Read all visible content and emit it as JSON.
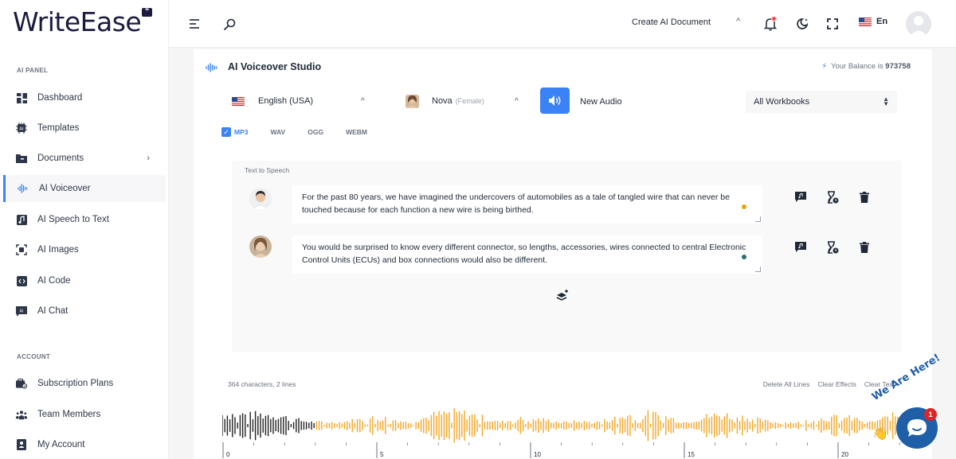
{
  "app": {
    "logo_text": "WriteEase",
    "logo_bubble": "❞"
  },
  "sidebar": {
    "section_ai": "AI PANEL",
    "section_account": "ACCOUNT",
    "items": [
      {
        "label": "Dashboard",
        "icon": "dashboard-icon"
      },
      {
        "label": "Templates",
        "icon": "templates-icon"
      },
      {
        "label": "Documents",
        "icon": "documents-icon"
      },
      {
        "label": "AI Voiceover",
        "icon": "voiceover-icon",
        "active": true
      },
      {
        "label": "AI Speech to Text",
        "icon": "speech-to-text-icon"
      },
      {
        "label": "AI Images",
        "icon": "images-icon"
      },
      {
        "label": "AI Code",
        "icon": "code-icon"
      },
      {
        "label": "AI Chat",
        "icon": "chat-icon"
      }
    ],
    "account_items": [
      {
        "label": "Subscription Plans",
        "icon": "subscription-icon"
      },
      {
        "label": "Team Members",
        "icon": "team-icon"
      },
      {
        "label": "My Account",
        "icon": "account-icon"
      }
    ]
  },
  "topbar": {
    "create_doc": "Create AI Document",
    "language": "En"
  },
  "studio": {
    "title": "AI Voiceover Studio",
    "balance_label": "Your Balance is",
    "balance_value": "973758",
    "language": "English (USA)",
    "voice_name": "Nova",
    "voice_gender": "(Female)",
    "new_audio": "New Audio",
    "workbooks": "All Workbooks",
    "formats": [
      "MP3",
      "WAV",
      "OGG",
      "WEBM"
    ],
    "selected_format": "MP3",
    "tts_label": "Text to Speech",
    "lines": [
      {
        "text": "For the past 80 years, we have imagined the undercovers of automobiles as a tale of tangled wire that can never be touched because for each function a new wire is being birthed.",
        "dot_color": "#f0a500"
      },
      {
        "text": "You would be surprised to know every different connector, so lengths, accessories, wires connected to central Electronic Control Units (ECUs) and box connections would also be different.",
        "dot_color": "#2f6f73"
      }
    ],
    "counter": "364 characters, 2 lines",
    "delete_all": "Delete All Lines",
    "clear_effects": "Clear Effects",
    "clear_text": "Clear Text",
    "ruler_labels": [
      "0",
      "5",
      "10",
      "15",
      "20"
    ],
    "colors": {
      "accent": "#3b82f6",
      "wave_played": "#222222",
      "wave_unplayed": "#f5a623"
    }
  },
  "chat": {
    "badge": "1",
    "label": "We Are Here!"
  }
}
